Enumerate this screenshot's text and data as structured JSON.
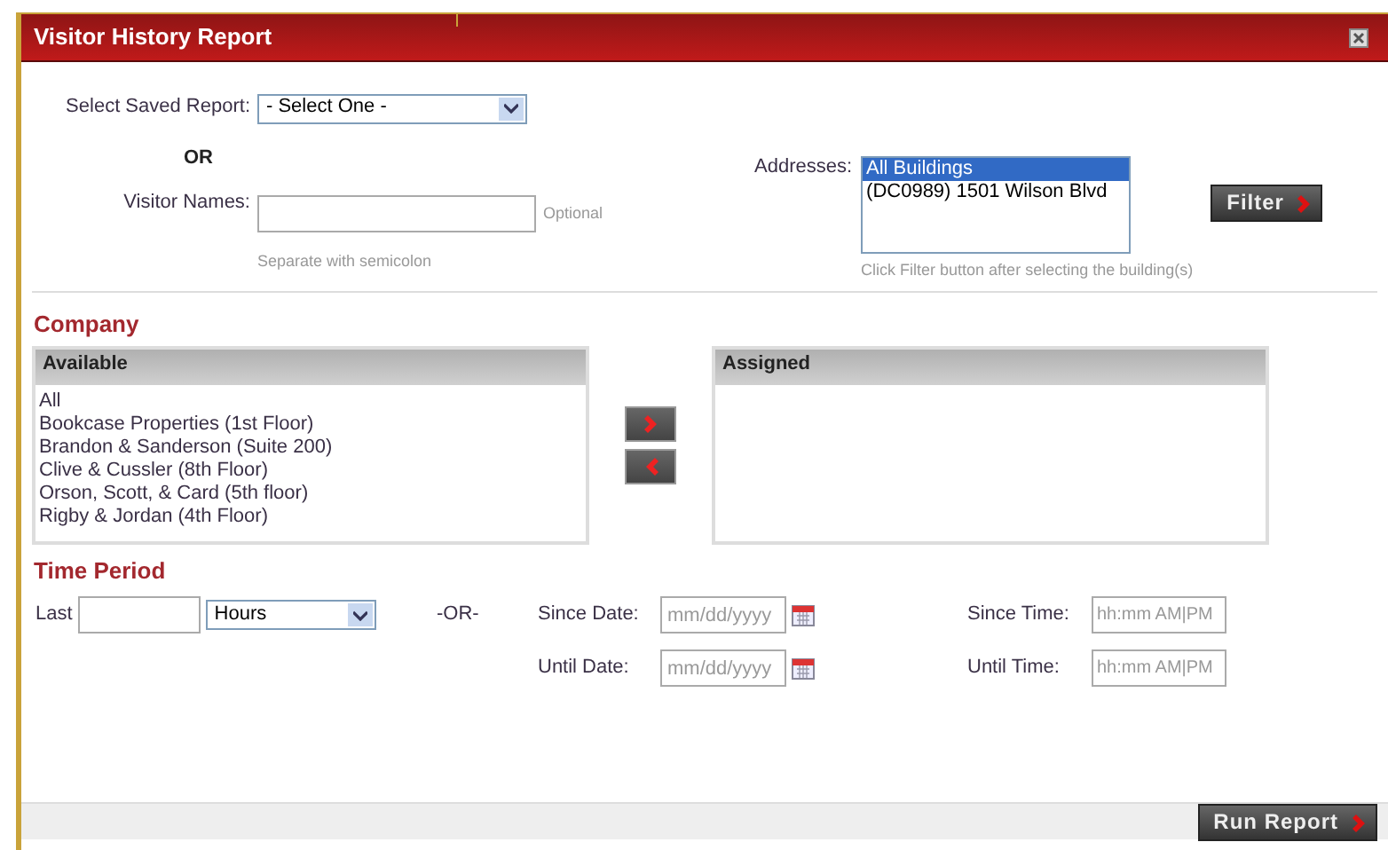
{
  "window": {
    "title": "Visitor History Report"
  },
  "saved_report": {
    "label": "Select Saved Report:",
    "value": "- Select One -"
  },
  "or_text": "OR",
  "visitor_names": {
    "label": "Visitor Names:",
    "note": "Optional",
    "hint": "Separate with semicolon"
  },
  "addresses": {
    "label": "Addresses:",
    "items": [
      {
        "text": "All Buildings",
        "selected": true
      },
      {
        "text": "(DC0989) 1501 Wilson Blvd",
        "selected": false
      }
    ],
    "hint": "Click Filter button after selecting the building(s)"
  },
  "filter_button": "Filter",
  "company": {
    "heading": "Company",
    "available": {
      "title": "Available",
      "items": [
        "All",
        "Bookcase Properties (1st Floor)",
        "Brandon & Sanderson (Suite 200)",
        "Clive & Cussler (8th Floor)",
        "Orson, Scott, & Card (5th floor)",
        "Rigby & Jordan (4th Floor)"
      ]
    },
    "assigned": {
      "title": "Assigned"
    }
  },
  "time_period": {
    "heading": "Time Period",
    "last_label": "Last",
    "unit": "Hours",
    "or_text": "-OR-",
    "fields": [
      {
        "label": "Since Date:",
        "placeholder": "mm/dd/yyyy",
        "kind": "date"
      },
      {
        "label": "Since Time:",
        "placeholder": "hh:mm AM|PM",
        "kind": "time"
      },
      {
        "label": "Until Date:",
        "placeholder": "mm/dd/yyyy",
        "kind": "date"
      },
      {
        "label": "Until Time:",
        "placeholder": "hh:mm AM|PM",
        "kind": "time"
      }
    ]
  },
  "run_button": "Run Report"
}
